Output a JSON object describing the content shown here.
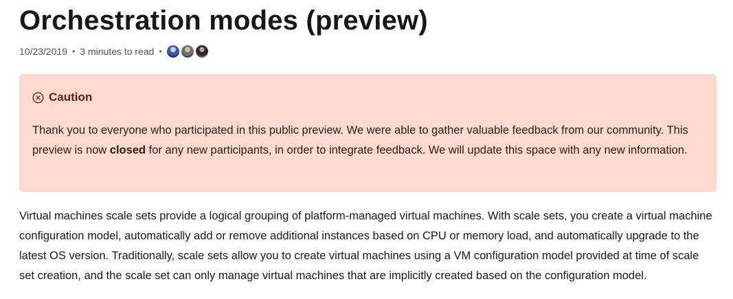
{
  "article": {
    "title": "Orchestration modes (preview)",
    "date": "10/23/2019",
    "separator": "•",
    "read_time": "3 minutes to read",
    "contributors": [
      "contributor-avatar-1",
      "contributor-avatar-2",
      "contributor-avatar-3"
    ]
  },
  "caution": {
    "icon": "circle-x-icon",
    "title": "Caution",
    "text_part1": "Thank you to everyone who participated in this public preview. We were able to gather valuable feedback from our community. This preview is now ",
    "text_bold": "closed",
    "text_part2": " for any new participants, in order to integrate feedback. We will update this space with any new information.",
    "colors": {
      "background": "#fdd9d0",
      "title": "#5c1f0e"
    }
  },
  "body": {
    "paragraph": "Virtual machines scale sets provide a logical grouping of platform-managed virtual machines. With scale sets, you create a virtual machine configuration model, automatically add or remove additional instances based on CPU or memory load, and automatically upgrade to the latest OS version. Traditionally, scale sets allow you to create virtual machines using a VM configuration model provided at time of scale set creation, and the scale set can only manage virtual machines that are implicitly created based on the configuration model."
  }
}
